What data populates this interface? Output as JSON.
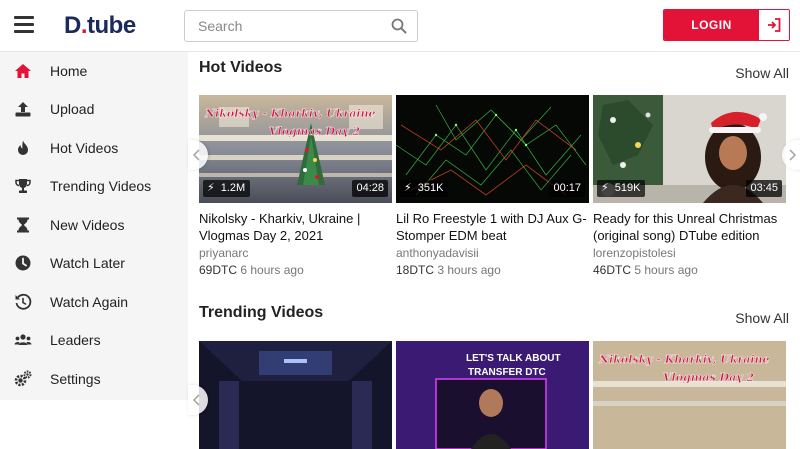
{
  "header": {
    "logo": {
      "brand_prefix": "D",
      "brand_dot": ".",
      "brand_suffix": "tube"
    },
    "search_placeholder": "Search",
    "login_label": "LOGIN"
  },
  "sidebar": {
    "items": [
      {
        "label": "Home",
        "icon": "home-icon"
      },
      {
        "label": "Upload",
        "icon": "upload-icon"
      },
      {
        "label": "Hot Videos",
        "icon": "flame-icon"
      },
      {
        "label": "Trending Videos",
        "icon": "trophy-icon"
      },
      {
        "label": "New Videos",
        "icon": "hourglass-icon"
      },
      {
        "label": "Watch Later",
        "icon": "clock-icon"
      },
      {
        "label": "Watch Again",
        "icon": "history-icon"
      },
      {
        "label": "Leaders",
        "icon": "users-icon"
      },
      {
        "label": "Settings",
        "icon": "gears-icon"
      }
    ],
    "active_color": "#e31337"
  },
  "sections": {
    "hot": {
      "title": "Hot Videos",
      "show_all": "Show All",
      "videos": [
        {
          "views": "1.2M",
          "duration": "04:28",
          "title": "Nikolsky - Kharkiv, Ukraine | Vlogmas Day 2, 2021",
          "author": "priyanarc",
          "dtc": "69DTC",
          "time": "6 hours ago",
          "thumb_text_1": "Nikolsky - Kharkiv, Ukraine",
          "thumb_text_2": "Vlogmas Day 2"
        },
        {
          "views": "351K",
          "duration": "00:17",
          "title": "Lil Ro Freestyle 1 with DJ Aux G-Stomper EDM beat",
          "author": "anthonyadavisii",
          "dtc": "18DTC",
          "time": "3 hours ago"
        },
        {
          "views": "519K",
          "duration": "03:45",
          "title": "Ready for this Unreal Christmas (original song) DTube edition",
          "author": "lorenzopistolesi",
          "dtc": "46DTC",
          "time": "5 hours ago"
        }
      ]
    },
    "trending": {
      "title": "Trending Videos",
      "show_all": "Show All",
      "videos": [
        {
          "thumb_text_1": ""
        },
        {
          "thumb_text_1": "LET'S TALK ABOUT",
          "thumb_text_2": "TRANSFER DTC"
        },
        {
          "thumb_text_1": "Nikolsky - Kharkiv, Ukraine",
          "thumb_text_2": "Vlogmas Day 2"
        }
      ]
    }
  },
  "colors": {
    "brand_red": "#e31337",
    "logo_navy": "#1a2a5a"
  }
}
